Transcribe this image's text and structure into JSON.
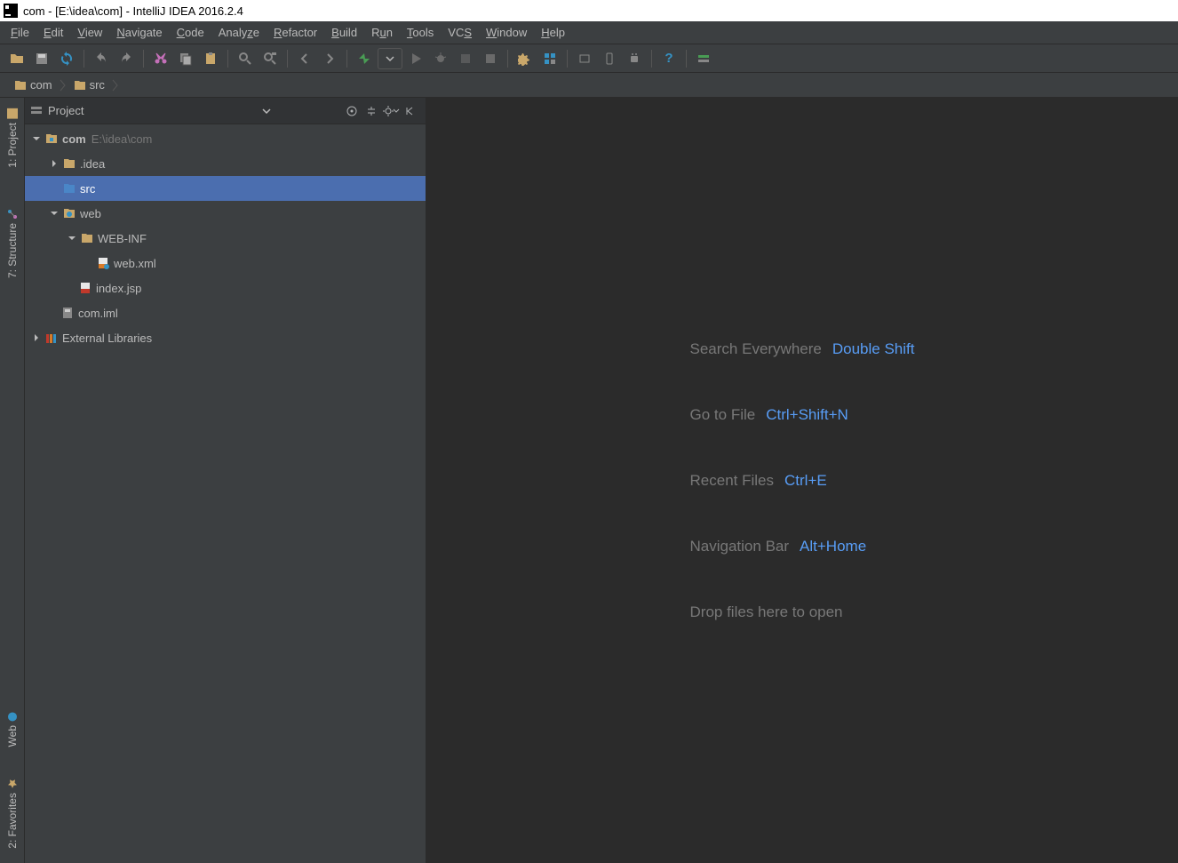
{
  "titlebar": {
    "text": "com - [E:\\idea\\com] - IntelliJ IDEA 2016.2.4"
  },
  "menubar": {
    "items": [
      "File",
      "Edit",
      "View",
      "Navigate",
      "Code",
      "Analyze",
      "Refactor",
      "Build",
      "Run",
      "Tools",
      "VCS",
      "Window",
      "Help"
    ]
  },
  "breadcrumb": {
    "items": [
      "com",
      "src"
    ]
  },
  "project_panel": {
    "title": "Project",
    "tree": [
      {
        "label": "com",
        "dim": "E:\\idea\\com"
      },
      {
        "label": ".idea"
      },
      {
        "label": "src"
      },
      {
        "label": "web"
      },
      {
        "label": "WEB-INF"
      },
      {
        "label": "web.xml"
      },
      {
        "label": "index.jsp"
      },
      {
        "label": "com.iml"
      },
      {
        "label": "External Libraries"
      }
    ]
  },
  "left_strip": {
    "project": "1: Project",
    "structure": "7: Structure",
    "web": "Web",
    "favorites": "2: Favorites"
  },
  "welcome": {
    "rows": [
      {
        "label": "Search Everywhere",
        "key": "Double Shift"
      },
      {
        "label": "Go to File",
        "key": "Ctrl+Shift+N"
      },
      {
        "label": "Recent Files",
        "key": "Ctrl+E"
      },
      {
        "label": "Navigation Bar",
        "key": "Alt+Home"
      },
      {
        "label": "Drop files here to open",
        "key": ""
      }
    ]
  }
}
